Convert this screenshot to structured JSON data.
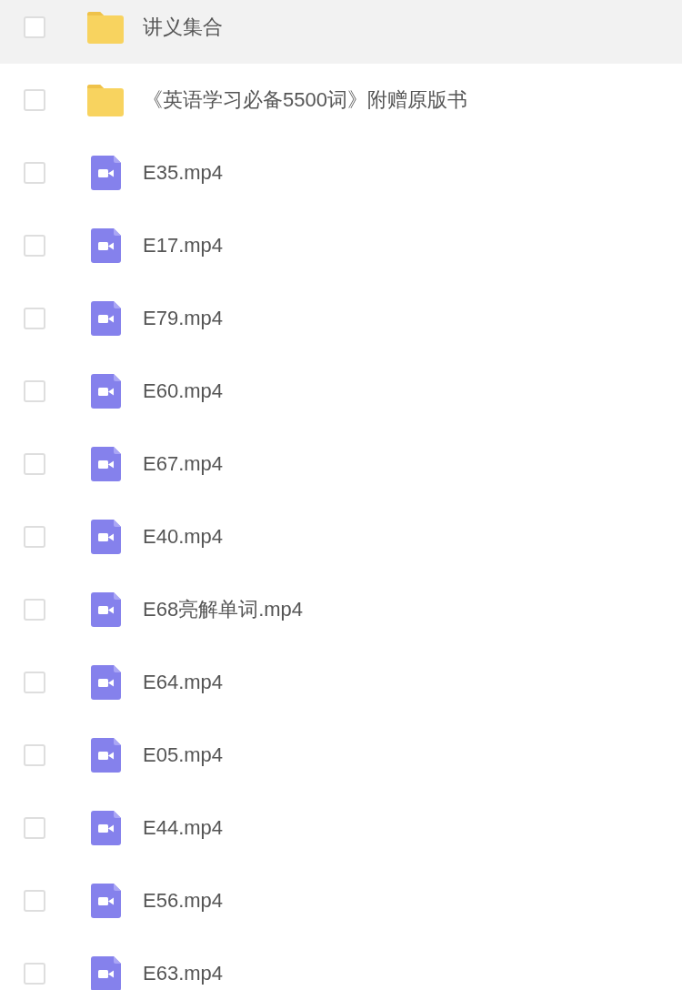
{
  "files": [
    {
      "kind": "folder",
      "name": "讲义集合",
      "selected": true,
      "checked": false
    },
    {
      "kind": "folder",
      "name": "《英语学习必备5500词》附赠原版书",
      "selected": false,
      "checked": false
    },
    {
      "kind": "video",
      "name": "E35.mp4",
      "selected": false,
      "checked": false
    },
    {
      "kind": "video",
      "name": "E17.mp4",
      "selected": false,
      "checked": false
    },
    {
      "kind": "video",
      "name": "E79.mp4",
      "selected": false,
      "checked": false
    },
    {
      "kind": "video",
      "name": "E60.mp4",
      "selected": false,
      "checked": false
    },
    {
      "kind": "video",
      "name": "E67.mp4",
      "selected": false,
      "checked": false
    },
    {
      "kind": "video",
      "name": "E40.mp4",
      "selected": false,
      "checked": false
    },
    {
      "kind": "video",
      "name": "E68亮解单词.mp4",
      "selected": false,
      "checked": false
    },
    {
      "kind": "video",
      "name": "E64.mp4",
      "selected": false,
      "checked": false
    },
    {
      "kind": "video",
      "name": "E05.mp4",
      "selected": false,
      "checked": false
    },
    {
      "kind": "video",
      "name": "E44.mp4",
      "selected": false,
      "checked": false
    },
    {
      "kind": "video",
      "name": "E56.mp4",
      "selected": false,
      "checked": false
    },
    {
      "kind": "video",
      "name": "E63.mp4",
      "selected": false,
      "checked": false
    }
  ]
}
